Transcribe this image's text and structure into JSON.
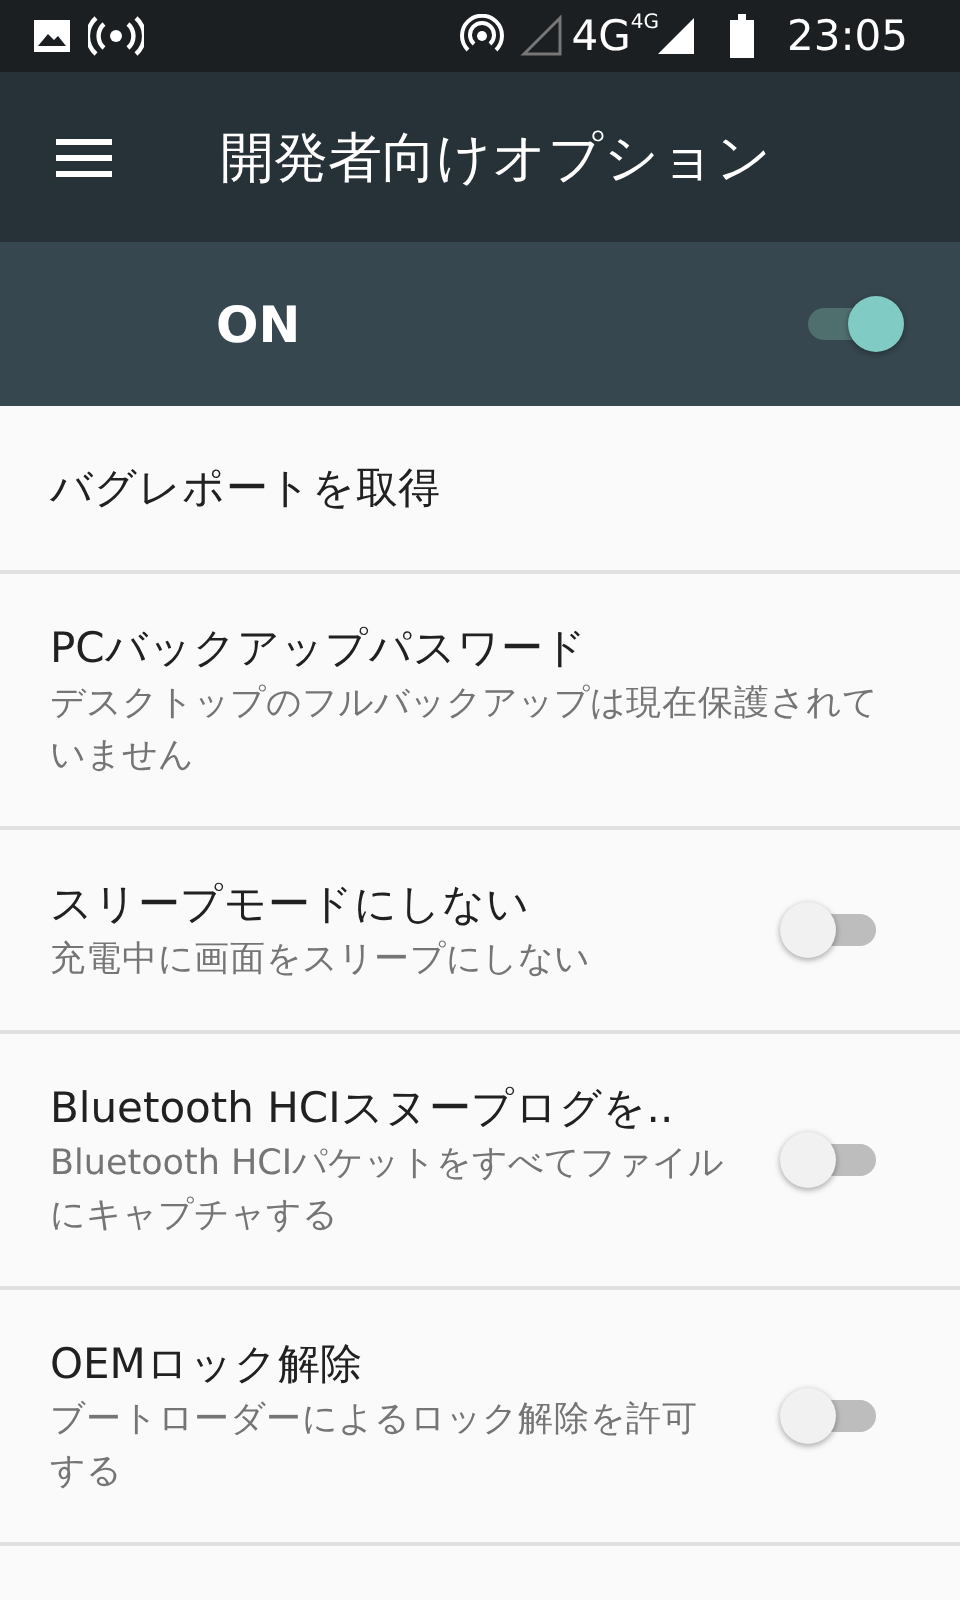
{
  "status_bar": {
    "time": "23:05",
    "network": "4G",
    "network_small": "4G"
  },
  "app_bar": {
    "title": "開発者向けオプション"
  },
  "master": {
    "label": "ON",
    "on": true
  },
  "items": [
    {
      "kind": "plain",
      "title": "バグレポートを取得"
    },
    {
      "kind": "plain",
      "title": "PCバックアップパスワード",
      "summary": "デスクトップのフルバックアップは現在保護されていません"
    },
    {
      "kind": "toggle",
      "title": "スリープモードにしない",
      "summary": "充電中に画面をスリープにしない",
      "on": false
    },
    {
      "kind": "toggle",
      "title": "Bluetooth HCIスヌープログを..",
      "summary": "Bluetooth HCIパケットをすべてファイルにキャプチャする",
      "on": false
    },
    {
      "kind": "toggle",
      "title": "OEMロック解除",
      "summary": "ブートローダーによるロック解除を許可する",
      "on": false
    }
  ]
}
